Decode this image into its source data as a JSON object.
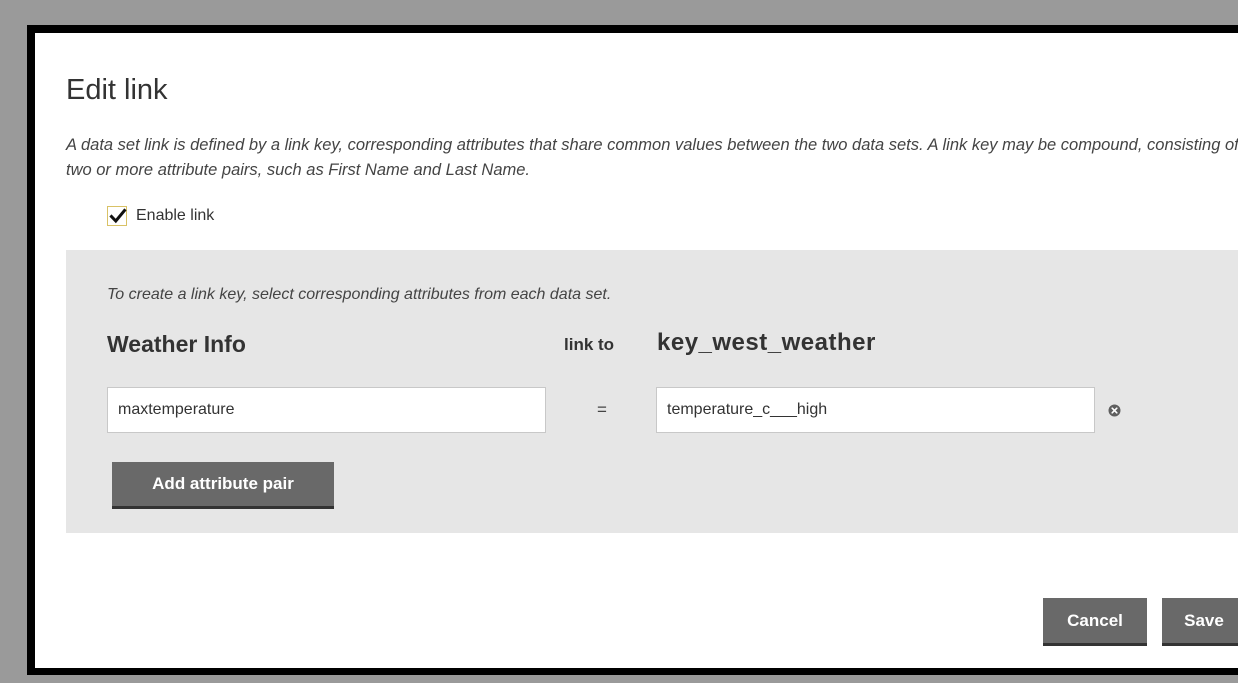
{
  "dialog": {
    "title": "Edit link",
    "description": "A data set link is defined by a link key, corresponding attributes that share common values between the two data sets. A link key may be compound, consisting of two or more attribute pairs, such as First Name and Last Name.",
    "enable_label": "Enable link",
    "enable_checked": true
  },
  "panel": {
    "hint": "To create a link key, select corresponding attributes from each data set.",
    "left_dataset": "Weather Info",
    "link_to_label": "link to",
    "right_dataset": "key_west_weather",
    "pairs": [
      {
        "left_value": "maxtemperature",
        "equals": "=",
        "right_value": "temperature_c___high",
        "remove_icon": "circle-x-icon"
      }
    ],
    "add_button_label": "Add attribute pair"
  },
  "footer": {
    "cancel_label": "Cancel",
    "save_label": "Save"
  },
  "colors": {
    "backdrop": "#9a9a9a",
    "dialog_border": "#000000",
    "panel_bg": "#e6e6e6",
    "button_bg": "#696969",
    "checkbox_border": "#d9c266"
  }
}
